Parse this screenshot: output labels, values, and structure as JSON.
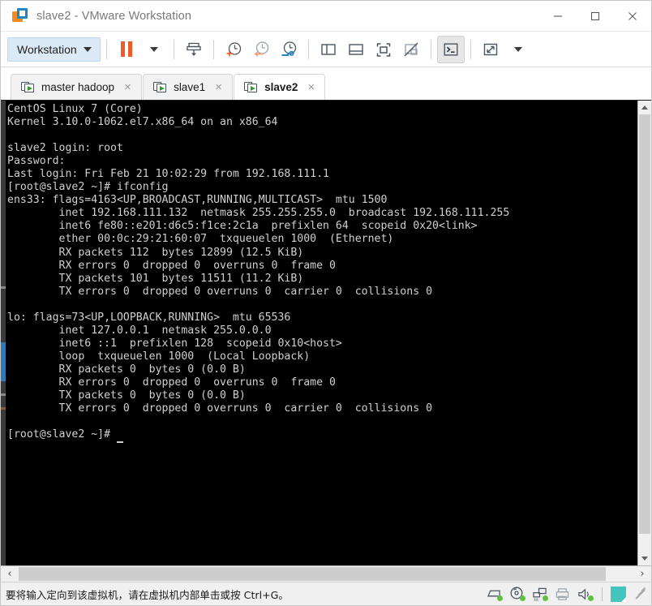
{
  "window": {
    "title": "slave2 - VMware Workstation",
    "logo_icon": "vmware-logo-icon",
    "minimize_label": "Minimize",
    "maximize_label": "Maximize",
    "close_label": "Close"
  },
  "toolbar": {
    "workstation_label": "Workstation",
    "items": [
      {
        "name": "pause-button",
        "icon": "pause-icon"
      },
      {
        "name": "power-dropdown",
        "icon": "chevron-down-icon"
      },
      {
        "name": "send-ctrl-alt-del-button",
        "icon": "send-to-vm-icon"
      },
      {
        "name": "take-snapshot-button",
        "icon": "snapshot-add-icon"
      },
      {
        "name": "revert-snapshot-button",
        "icon": "snapshot-revert-icon"
      },
      {
        "name": "snapshot-manager-button",
        "icon": "snapshot-manager-icon"
      },
      {
        "name": "show-library-button",
        "icon": "panel-left-icon"
      },
      {
        "name": "show-thumbnail-bar-button",
        "icon": "panel-bottom-icon"
      },
      {
        "name": "full-screen-button",
        "icon": "fullscreen-icon"
      },
      {
        "name": "unity-mode-button",
        "icon": "unity-mode-icon"
      },
      {
        "name": "console-view-button",
        "icon": "console-icon"
      },
      {
        "name": "stretch-guest-button",
        "icon": "expand-arrows-icon"
      },
      {
        "name": "stretch-dropdown",
        "icon": "chevron-down-icon"
      }
    ]
  },
  "tabs": [
    {
      "label": "master hadoop",
      "active": false,
      "icon": "vm-screen-play-icon",
      "close_glyph": "×"
    },
    {
      "label": "slave1",
      "active": false,
      "icon": "vm-screen-play-icon",
      "close_glyph": "×"
    },
    {
      "label": "slave2",
      "active": true,
      "icon": "vm-screen-play-icon",
      "close_glyph": "×"
    }
  ],
  "terminal": {
    "background": "#000000",
    "foreground": "#cfcfcf",
    "lines": [
      "CentOS Linux 7 (Core)",
      "Kernel 3.10.0-1062.el7.x86_64 on an x86_64",
      "",
      "slave2 login: root",
      "Password:",
      "Last login: Fri Feb 21 10:02:29 from 192.168.111.1",
      "[root@slave2 ~]# ifconfig",
      "ens33: flags=4163<UP,BROADCAST,RUNNING,MULTICAST>  mtu 1500",
      "        inet 192.168.111.132  netmask 255.255.255.0  broadcast 192.168.111.255",
      "        inet6 fe80::e201:d6c5:f1ce:2c1a  prefixlen 64  scopeid 0x20<link>",
      "        ether 00:0c:29:21:60:07  txqueuelen 1000  (Ethernet)",
      "        RX packets 112  bytes 12899 (12.5 KiB)",
      "        RX errors 0  dropped 0  overruns 0  frame 0",
      "        TX packets 101  bytes 11511 (11.2 KiB)",
      "        TX errors 0  dropped 0 overruns 0  carrier 0  collisions 0",
      "",
      "lo: flags=73<UP,LOOPBACK,RUNNING>  mtu 65536",
      "        inet 127.0.0.1  netmask 255.0.0.0",
      "        inet6 ::1  prefixlen 128  scopeid 0x10<host>",
      "        loop  txqueuelen 1000  (Local Loopback)",
      "        RX packets 0  bytes 0 (0.0 B)",
      "        RX errors 0  dropped 0  overruns 0  frame 0",
      "        TX packets 0  bytes 0 (0.0 B)",
      "        TX errors 0  dropped 0 overruns 0  carrier 0  collisions 0",
      ""
    ],
    "prompt": "[root@slave2 ~]# "
  },
  "scrollbars": {
    "vertical_up_label": "Scroll up",
    "vertical_down_label": "Scroll down",
    "horizontal_left_glyph": "‹",
    "horizontal_right_glyph": "›"
  },
  "statusbar": {
    "message": "要将输入定向到该虚拟机，请在虚拟机内部单击或按 Ctrl+G。",
    "devices": [
      {
        "name": "hard-disk-icon",
        "connected": true
      },
      {
        "name": "cd-dvd-icon",
        "connected": true
      },
      {
        "name": "network-adapter-icon",
        "connected": true
      },
      {
        "name": "printer-icon",
        "connected": false
      },
      {
        "name": "sound-card-icon",
        "connected": true
      }
    ],
    "doc_icon": "note-document-icon",
    "resize_grip": "resize-grip-icon"
  },
  "colors": {
    "accent_orange": "#f05a28",
    "accent_blue": "#1c86c8",
    "tab_active_bg": "#ffffff",
    "terminal_bg": "#000000",
    "device_connected": "#5ec23f"
  }
}
